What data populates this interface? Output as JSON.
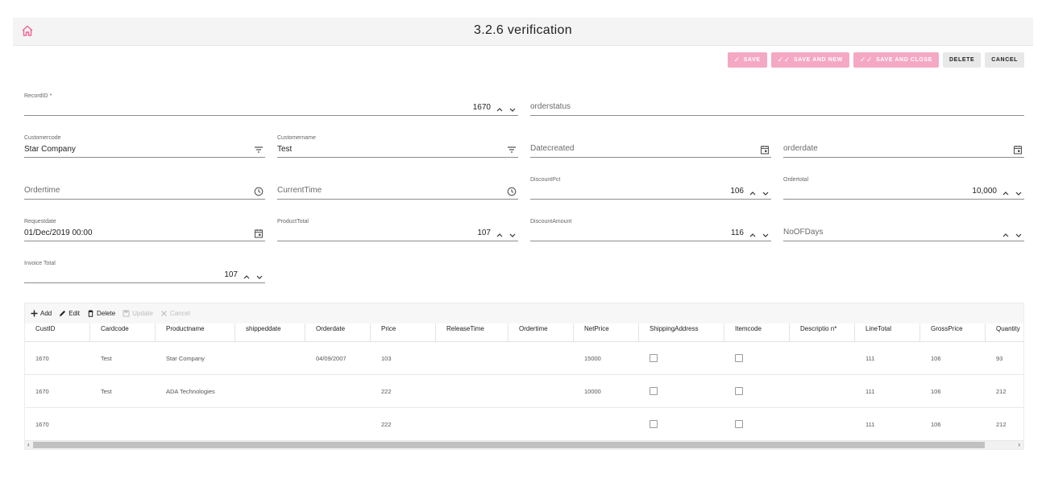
{
  "header": {
    "title": "3.2.6 verification",
    "home_icon": "home-icon"
  },
  "toolbar": {
    "save": "SAVE",
    "save_new": "SAVE AND NEW",
    "save_close": "SAVE AND CLOSE",
    "delete": "DELETE",
    "cancel": "CANCEL",
    "accent_color": "#f5a8c4"
  },
  "form": {
    "record_id": {
      "label": "RecordID *",
      "value": "1670"
    },
    "orderstatus": {
      "placeholder": "orderstatus"
    },
    "customercode": {
      "label": "Customercode",
      "value": "Star Company"
    },
    "customername": {
      "label": "Customername",
      "value": "Test"
    },
    "datecreated": {
      "placeholder": "Datecreated"
    },
    "orderdate": {
      "placeholder": "orderdate"
    },
    "ordertime": {
      "placeholder": "Ordertime"
    },
    "currenttime": {
      "placeholder": "CurrentTime"
    },
    "discountpct": {
      "label": "DiscountPct",
      "value": "106"
    },
    "ordertotal": {
      "label": "Ordertotal",
      "value": "10,000"
    },
    "requestdate": {
      "label": "Requestdate",
      "value": "01/Dec/2019 00:00"
    },
    "producttotal": {
      "label": "ProductTotal",
      "value": "107"
    },
    "discountamount": {
      "label": "DiscountAmount",
      "value": "116"
    },
    "noofdays": {
      "placeholder": "NoOFDays"
    },
    "invoicetotal": {
      "label": "Invoice Total",
      "value": "107"
    }
  },
  "grid": {
    "toolbar": {
      "add": "Add",
      "edit": "Edit",
      "delete": "Delete",
      "update": "Update",
      "cancel": "Cancel"
    },
    "columns": [
      "CustID",
      "Cardcode",
      "Productname",
      "shippeddate",
      "Orderdate",
      "Price",
      "ReleaseTime",
      "Ordertime",
      "NetPrice",
      "ShippingAddress",
      "Itemcode",
      "Descriptio n*",
      "LineTotal",
      "GrossPrice",
      "Quantity"
    ],
    "rows": [
      [
        "1670",
        "Test",
        "Star Company",
        "",
        "04/09/2007",
        "103",
        "",
        "",
        "15000",
        "",
        "",
        "",
        "111",
        "106",
        "93"
      ],
      [
        "1670",
        "Test",
        "ADA Technologies",
        "",
        "",
        "222",
        "",
        "",
        "10000",
        "",
        "",
        "",
        "111",
        "106",
        "212"
      ],
      [
        "1670",
        "",
        "",
        "",
        "",
        "222",
        "",
        "",
        "",
        "",
        "",
        "",
        "111",
        "106",
        "212"
      ]
    ]
  }
}
